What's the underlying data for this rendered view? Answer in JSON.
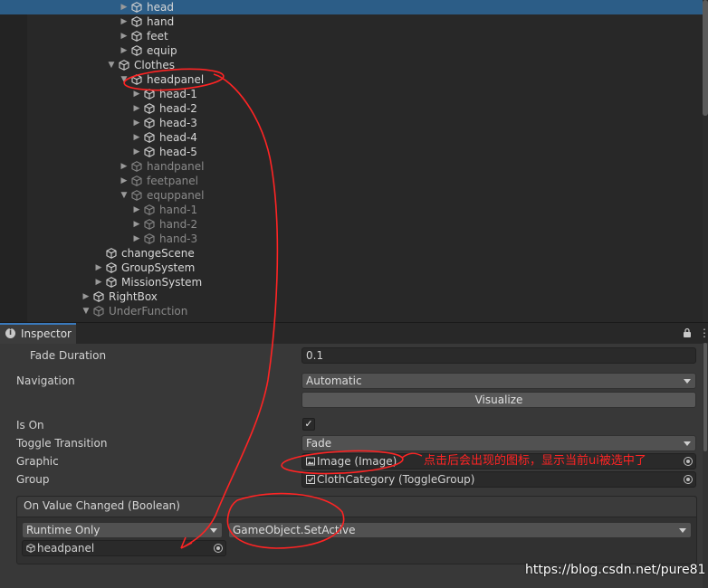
{
  "hierarchy": {
    "rows": [
      {
        "label": "head",
        "indent": 2,
        "arrow": "right",
        "selected": true,
        "dim": false
      },
      {
        "label": "hand",
        "indent": 2,
        "arrow": "right",
        "selected": false,
        "dim": false
      },
      {
        "label": "feet",
        "indent": 2,
        "arrow": "right",
        "selected": false,
        "dim": false
      },
      {
        "label": "equip",
        "indent": 2,
        "arrow": "right",
        "selected": false,
        "dim": false
      },
      {
        "label": "Clothes",
        "indent": 1,
        "arrow": "down",
        "selected": false,
        "dim": false
      },
      {
        "label": "headpanel",
        "indent": 2,
        "arrow": "down",
        "selected": false,
        "dim": false
      },
      {
        "label": "head-1",
        "indent": 3,
        "arrow": "right",
        "selected": false,
        "dim": false
      },
      {
        "label": "head-2",
        "indent": 3,
        "arrow": "right",
        "selected": false,
        "dim": false
      },
      {
        "label": "head-3",
        "indent": 3,
        "arrow": "right",
        "selected": false,
        "dim": false
      },
      {
        "label": "head-4",
        "indent": 3,
        "arrow": "right",
        "selected": false,
        "dim": false
      },
      {
        "label": "head-5",
        "indent": 3,
        "arrow": "right",
        "selected": false,
        "dim": false
      },
      {
        "label": "handpanel",
        "indent": 2,
        "arrow": "right",
        "selected": false,
        "dim": true
      },
      {
        "label": "feetpanel",
        "indent": 2,
        "arrow": "right",
        "selected": false,
        "dim": true
      },
      {
        "label": "equppanel",
        "indent": 2,
        "arrow": "down",
        "selected": false,
        "dim": true
      },
      {
        "label": "hand-1",
        "indent": 3,
        "arrow": "right",
        "selected": false,
        "dim": true
      },
      {
        "label": "hand-2",
        "indent": 3,
        "arrow": "right",
        "selected": false,
        "dim": true
      },
      {
        "label": "hand-3",
        "indent": 3,
        "arrow": "right",
        "selected": false,
        "dim": true
      },
      {
        "label": "changeScene",
        "indent": 0,
        "arrow": "none",
        "selected": false,
        "dim": false
      },
      {
        "label": "GroupSystem",
        "indent": 0,
        "arrow": "right",
        "selected": false,
        "dim": false
      },
      {
        "label": "MissionSystem",
        "indent": 0,
        "arrow": "right",
        "selected": false,
        "dim": false
      },
      {
        "label": "RightBox",
        "indent": -1,
        "arrow": "right",
        "selected": false,
        "dim": false
      },
      {
        "label": "UnderFunction",
        "indent": -1,
        "arrow": "down",
        "selected": false,
        "dim": true
      }
    ]
  },
  "inspector": {
    "tab_label": "Inspector",
    "fade_duration": {
      "label": "Fade Duration",
      "value": "0.1"
    },
    "navigation": {
      "label": "Navigation",
      "value": "Automatic"
    },
    "visualize_label": "Visualize",
    "is_on": {
      "label": "Is On",
      "checked": true,
      "glyph": "✓"
    },
    "toggle_transition": {
      "label": "Toggle Transition",
      "value": "Fade"
    },
    "graphic": {
      "label": "Graphic",
      "value": "Image (Image)"
    },
    "group": {
      "label": "Group",
      "value": "ClothCategory (ToggleGroup)"
    },
    "on_value_changed": {
      "title": "On Value Changed (Boolean)",
      "runtime": "Runtime Only",
      "function": "GameObject.SetActive",
      "target": "headpanel"
    }
  },
  "annotation": {
    "text": "点击后会出现的图标，显示当前ui被选中了",
    "color": "#ff2424"
  },
  "watermark": "https://blog.csdn.net/pure81",
  "colors": {
    "selection": "#2c5d87",
    "tab_accent": "#3a79bb",
    "annotation": "#ff2424"
  }
}
